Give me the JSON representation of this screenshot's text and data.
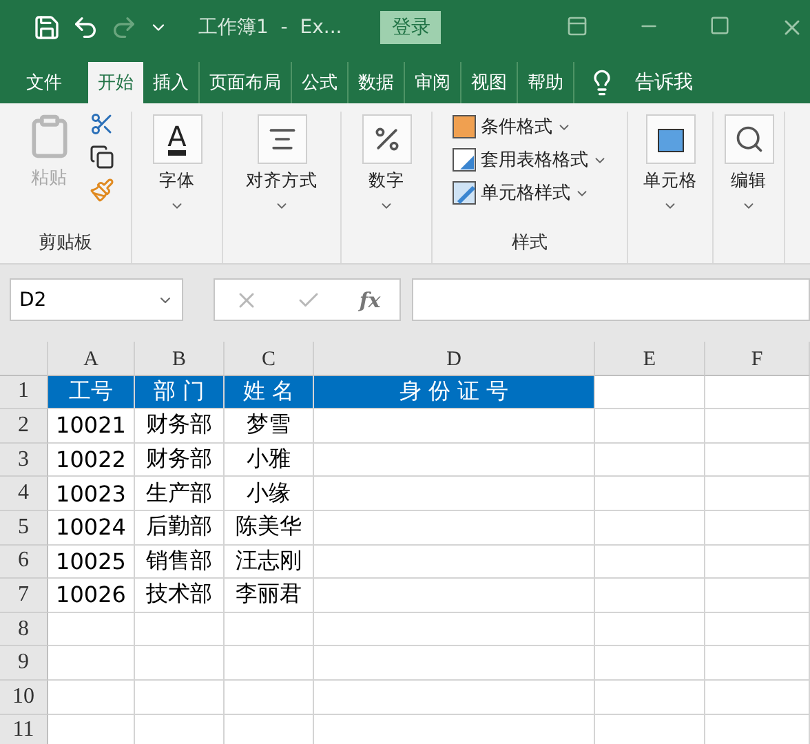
{
  "title_bar": {
    "title": "工作簿1  -  Ex...",
    "login_button": "登录"
  },
  "tabs": [
    {
      "label": "文件",
      "selected": false
    },
    {
      "label": "开始",
      "selected": true
    },
    {
      "label": "插入",
      "selected": false
    },
    {
      "label": "页面布局",
      "selected": false
    },
    {
      "label": "公式",
      "selected": false
    },
    {
      "label": "数据",
      "selected": false
    },
    {
      "label": "审阅",
      "selected": false
    },
    {
      "label": "视图",
      "selected": false
    },
    {
      "label": "帮助",
      "selected": false
    }
  ],
  "tell_me": "告诉我",
  "ribbon": {
    "clipboard": {
      "paste": "粘贴",
      "paste_disabled": true,
      "label": "剪贴板"
    },
    "big_buttons": [
      {
        "kind": "font",
        "label": "字体",
        "glyph": "A"
      },
      {
        "kind": "align",
        "label": "对齐方式"
      },
      {
        "kind": "number",
        "label": "数字"
      }
    ],
    "styles": {
      "items": [
        {
          "kind": "conditional",
          "label": "条件格式"
        },
        {
          "kind": "table",
          "label": "套用表格格式"
        },
        {
          "kind": "cell",
          "label": "单元格样式"
        }
      ],
      "label": "样式"
    },
    "right_buttons": [
      {
        "kind": "cells",
        "label": "单元格"
      },
      {
        "kind": "edit",
        "label": "编辑"
      }
    ]
  },
  "formula_bar": {
    "name_box": "D2",
    "function_button": "fx"
  },
  "sheet": {
    "columns": [
      "A",
      "B",
      "C",
      "D",
      "E",
      "F"
    ],
    "row_numbers": [
      "1",
      "2",
      "3",
      "4",
      "5",
      "6",
      "7",
      "8",
      "9",
      "10",
      "11"
    ],
    "header_row": [
      "工号",
      "部 门",
      "姓 名",
      "身 份 证 号"
    ],
    "rows": [
      [
        "10021",
        "财务部",
        "梦雪"
      ],
      [
        "10022",
        "财务部",
        "小雅"
      ],
      [
        "10023",
        "生产部",
        "小缘"
      ],
      [
        "10024",
        "后勤部",
        "陈美华"
      ],
      [
        "10025",
        "销售部",
        "汪志刚"
      ],
      [
        "10026",
        "技术部",
        "李丽君"
      ]
    ]
  }
}
